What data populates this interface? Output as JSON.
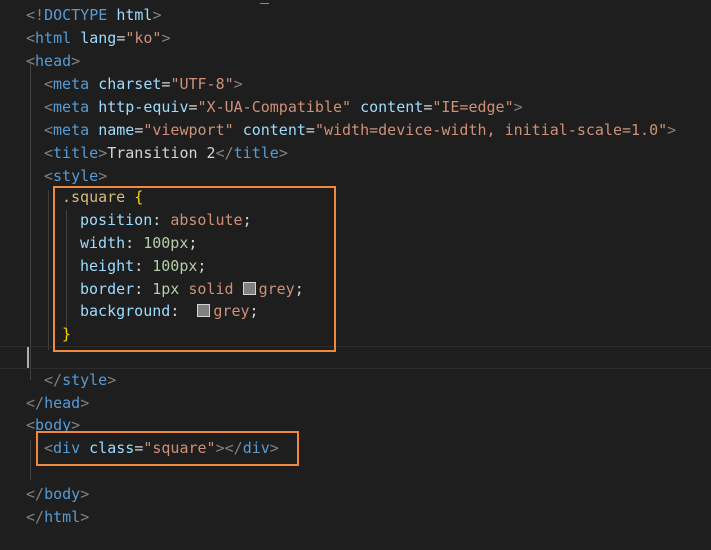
{
  "editor": {
    "accent_color": "#f0883e",
    "swatch_color": "#808080",
    "lines": {
      "l1": {
        "lt": "<!",
        "tag": "DOCTYPE",
        "sp": " ",
        "val": "html",
        "gt": ">"
      },
      "l2": {
        "lt": "<",
        "tag": "html",
        "sp": " ",
        "attr": "lang",
        "eq": "=",
        "str": "\"ko\"",
        "gt": ">"
      },
      "l3": {
        "lt": "<",
        "tag": "head",
        "gt": ">"
      },
      "l4": {
        "lt": "<",
        "tag": "meta",
        "sp": " ",
        "attr": "charset",
        "eq": "=",
        "str": "\"UTF-8\"",
        "gt": ">"
      },
      "l5": {
        "lt": "<",
        "tag": "meta",
        "sp": " ",
        "attr1": "http-equiv",
        "eq1": "=",
        "str1": "\"X-UA-Compatible\"",
        "sp2": " ",
        "attr2": "content",
        "eq2": "=",
        "str2": "\"IE=edge\"",
        "gt": ">"
      },
      "l6": {
        "lt": "<",
        "tag": "meta",
        "sp": " ",
        "attr1": "name",
        "eq1": "=",
        "str1": "\"viewport\"",
        "sp2": " ",
        "attr2": "content",
        "eq2": "=",
        "str2": "\"width=device-width, initial-scale=1.0\"",
        "gt": ">"
      },
      "l7": {
        "lt": "<",
        "tag": "title",
        "gt": ">",
        "text": "Transition 2",
        "lt2": "</",
        "tag2": "title",
        "gt2": ">"
      },
      "l8": {
        "lt": "<",
        "tag": "style",
        "gt": ">"
      },
      "l9": {
        "selector": ".square",
        "sp": " ",
        "brace": "{"
      },
      "l10": {
        "prop": "position",
        "colon": ":",
        "sp": " ",
        "val": "absolute",
        "semi": ";"
      },
      "l11": {
        "prop": "width",
        "colon": ":",
        "sp": " ",
        "num": "100px",
        "semi": ";"
      },
      "l12": {
        "prop": "height",
        "colon": ":",
        "sp": " ",
        "num": "100px",
        "semi": ";"
      },
      "l13": {
        "prop": "border",
        "colon": ":",
        "sp": " ",
        "num": "1px",
        "sp2": " ",
        "val": "solid",
        "sp3": " ",
        "val2": "grey",
        "semi": ";"
      },
      "l14": {
        "prop": "background",
        "colon": ":",
        "sp": " ",
        "val": "grey",
        "semi": ";"
      },
      "l15": {
        "brace": "}"
      },
      "l17": {
        "lt": "</",
        "tag": "style",
        "gt": ">"
      },
      "l18": {
        "lt": "</",
        "tag": "head",
        "gt": ">"
      },
      "l19": {
        "lt": "<",
        "tag": "body",
        "gt": ">"
      },
      "l20": {
        "lt": "<",
        "tag": "div",
        "sp": " ",
        "attr": "class",
        "eq": "=",
        "str": "\"square\"",
        "gt": ">",
        "lt2": "</",
        "tag2": "div",
        "gt2": ">"
      },
      "l22": {
        "lt": "</",
        "tag": "body",
        "gt": ">"
      },
      "l23": {
        "lt": "</",
        "tag": "html",
        "gt": ">"
      }
    }
  }
}
